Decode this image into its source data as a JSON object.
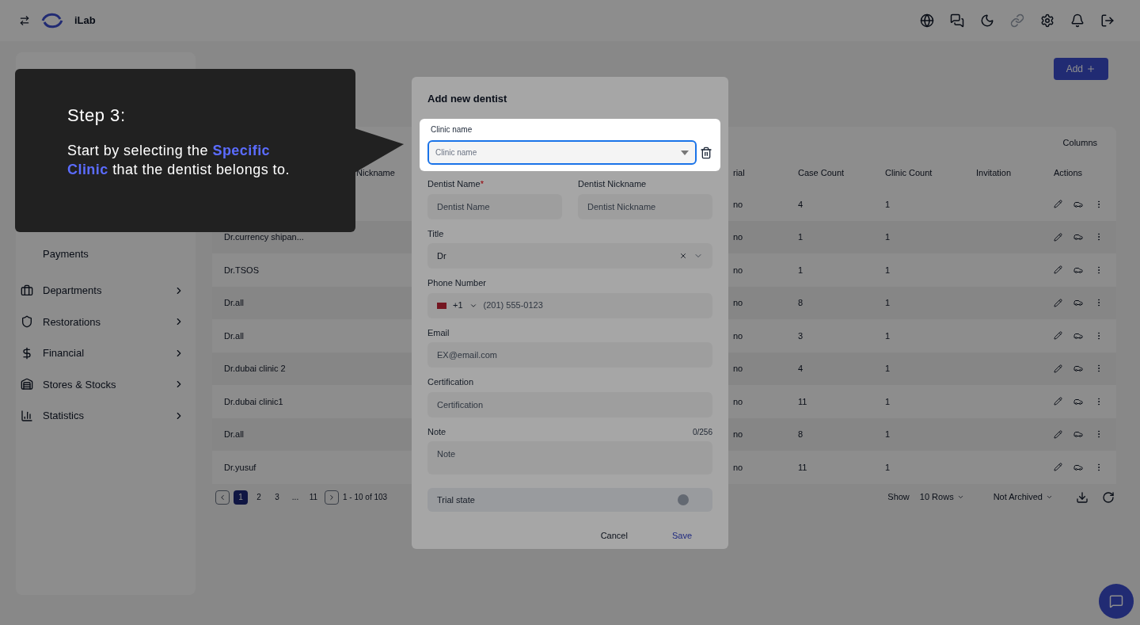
{
  "topbar": {
    "logo_text": "iLab"
  },
  "sidebar": {
    "subitems": [
      "Payments"
    ],
    "items": [
      {
        "label": "Departments"
      },
      {
        "label": "Restorations"
      },
      {
        "label": "Financial"
      },
      {
        "label": "Stores & Stocks"
      },
      {
        "label": "Statistics"
      }
    ]
  },
  "page": {
    "add_button": "Add",
    "columns_button": "Columns"
  },
  "table": {
    "columns": [
      "Nickname",
      "rial",
      "Case Count",
      "Clinic Count",
      "Invitation",
      "Actions"
    ],
    "rows": [
      {
        "trial": "no",
        "case_count": "4",
        "clinic_count": "1"
      },
      {
        "name": "Dr.currency shipan...",
        "trial": "no",
        "case_count": "1",
        "clinic_count": "1"
      },
      {
        "name": "Dr.TSOS",
        "trial": "no",
        "case_count": "1",
        "clinic_count": "1"
      },
      {
        "name": "Dr.all",
        "trial": "no",
        "case_count": "8",
        "clinic_count": "1"
      },
      {
        "name": "Dr.all",
        "trial": "no",
        "case_count": "3",
        "clinic_count": "1"
      },
      {
        "name": "Dr.dubai clinic 2",
        "trial": "no",
        "case_count": "4",
        "clinic_count": "1"
      },
      {
        "name": "Dr.dubai clinic1",
        "trial": "no",
        "case_count": "11",
        "clinic_count": "1"
      },
      {
        "name": "Dr.all",
        "trial": "no",
        "case_count": "8",
        "clinic_count": "1"
      },
      {
        "name": "Dr.yusuf",
        "trial": "no",
        "case_count": "11",
        "clinic_count": "1"
      }
    ]
  },
  "pagination": {
    "pages": [
      {
        "label": "1",
        "selected": true
      },
      {
        "label": "2",
        "selected": false
      },
      {
        "label": "3",
        "selected": false
      },
      {
        "label": "...",
        "selected": false
      },
      {
        "label": "11",
        "selected": false
      }
    ],
    "range": "1 - 10 of 103",
    "show_label": "Show",
    "rows_select": "10 Rows",
    "archive_select": "Not Archived"
  },
  "modal": {
    "title": "Add new dentist",
    "clinic": {
      "label": "Clinic name",
      "placeholder": "Clinic name"
    },
    "fields": [
      {
        "kind": "pair",
        "items": [
          {
            "label": "Dentist Name",
            "required_mark": "*",
            "placeholder": "Dentist Name"
          },
          {
            "label": "Dentist Nickname",
            "placeholder": "Dentist Nickname"
          }
        ]
      },
      {
        "kind": "select",
        "label": "Title",
        "value": "Dr"
      },
      {
        "kind": "phone",
        "label": "Phone Number",
        "code": "+1",
        "placeholder": "(201) 555-0123"
      },
      {
        "kind": "text",
        "label": "Email",
        "placeholder": "EX@email.com"
      },
      {
        "kind": "text",
        "label": "Certification",
        "placeholder": "Certification"
      },
      {
        "kind": "textarea",
        "label": "Note",
        "counter": "0/256",
        "placeholder": "Note"
      },
      {
        "kind": "toggle",
        "label": "Trial state",
        "on": false
      }
    ],
    "buttons": [
      "Cancel",
      "Save"
    ]
  },
  "tour": {
    "title": "Step 3:",
    "body": "Start by selecting the **Specific Clinic** that the dentist belongs to."
  }
}
